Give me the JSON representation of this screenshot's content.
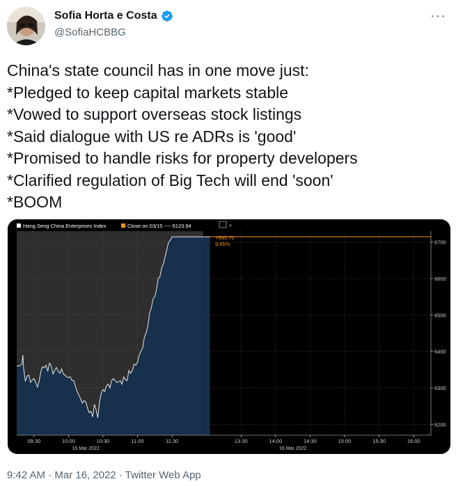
{
  "author": {
    "name": "Sofia Horta e Costa",
    "handle": "@SofiaHCBBG",
    "avatar_icon": "profile-photo"
  },
  "tweet": {
    "lines": [
      "China's state council has in one move just:",
      "*Pledged to keep capital markets stable",
      "*Vowed to support overseas stock listings",
      "*Said dialogue with US re ADRs is 'good'",
      "*Promised to handle risks for property developers",
      "*Clarified regulation of Big Tech will end 'soon'",
      "*BOOM"
    ],
    "timestamp": "9:42 AM · Mar 16, 2022 · Twitter Web App"
  },
  "colors": {
    "accent": "#1d9bf0",
    "text": "#0f1419",
    "muted": "#536471",
    "chart_fill": "#16304d",
    "chart_line": "#e8e8e8",
    "close_line": "#f7931a"
  },
  "chart_data": {
    "type": "area",
    "legend": [
      {
        "label": "Hang Seng China Enterprises Index",
        "swatch": "#ffffff"
      },
      {
        "label": "Close on 03/15 ---- 6123.94",
        "swatch": "#f7931a"
      }
    ],
    "annotation": {
      "value": "+590.70",
      "pct": "9.65%"
    },
    "x_ticks": [
      "09:30",
      "10:00",
      "10:30",
      "11:00",
      "11:30",
      "13:30",
      "14:00",
      "14:30",
      "15:00",
      "15:30",
      "16:00"
    ],
    "date_labels": [
      "16 Mar 2022",
      "16 Mar 2022"
    ],
    "y_ticks": [
      6200,
      6300,
      6400,
      6500,
      6600,
      6700
    ],
    "ylim": [
      6170,
      6730
    ],
    "close_level": 6714.6,
    "series": [
      {
        "x": [
          0,
          0.75,
          1.5,
          1.8,
          2,
          2.25,
          2.5,
          3,
          3.5,
          4,
          4.5,
          5,
          5.5,
          6,
          6.5,
          7,
          7.5,
          8,
          8.5,
          9,
          9.5,
          10,
          10.5,
          11,
          11.5,
          12,
          12.5,
          13,
          13.5,
          14,
          14.5,
          15,
          15.5,
          16,
          16.5,
          17,
          17.5,
          18,
          18.5,
          19,
          19.5,
          20,
          20.5,
          21,
          21.5,
          22,
          22.5,
          23,
          23.5,
          24,
          24.5,
          25,
          25.5,
          26,
          26.5,
          27,
          27.5,
          28,
          28.5,
          29,
          29.5,
          30,
          30.5,
          31,
          31.5,
          32,
          32.5,
          33,
          33.5,
          34,
          34.5,
          35,
          35.5,
          36,
          36.5,
          37,
          37.5,
          38,
          38.5,
          39,
          39.5,
          40,
          40.5,
          41,
          41.5,
          42,
          42.5,
          43,
          43.5,
          44,
          44.5,
          45,
          45.5,
          46,
          46.5,
          47,
          47.5,
          48,
          48.5,
          49,
          49.5,
          50,
          50.5,
          51,
          51.5,
          52,
          52.5,
          53,
          53.5,
          54,
          54.5,
          55,
          55.5,
          56
        ],
        "values": [
          6360,
          6360,
          6365,
          6390,
          6355,
          6335,
          6318,
          6332,
          6335,
          6315,
          6322,
          6325,
          6315,
          6302,
          6318,
          6345,
          6358,
          6355,
          6362,
          6345,
          6368,
          6360,
          6338,
          6348,
          6356,
          6345,
          6340,
          6352,
          6338,
          6335,
          6330,
          6328,
          6330,
          6320,
          6320,
          6305,
          6290,
          6280,
          6270,
          6258,
          6265,
          6262,
          6245,
          6232,
          6236,
          6220,
          6255,
          6240,
          6218,
          6262,
          6285,
          6295,
          6290,
          6305,
          6310,
          6300,
          6320,
          6325,
          6320,
          6315,
          6316,
          6320,
          6310,
          6330,
          6322,
          6320,
          6348,
          6340,
          6348,
          6365,
          6362,
          6370,
          6390,
          6400,
          6410,
          6440,
          6450,
          6470,
          6505,
          6520,
          6545,
          6550,
          6570,
          6600,
          6605,
          6630,
          6640,
          6660,
          6680,
          6700,
          6705,
          6714.6,
          6714.6,
          6714.6,
          6714.6,
          6714.6,
          6714.6,
          6714.6,
          6714.6,
          6714.6,
          6714.6,
          6714.6,
          6714.6,
          6714.6,
          6714.6,
          6714.6,
          6714.6,
          6714.6,
          6714.6,
          6714.6,
          6714.6,
          6714.6,
          6714.6,
          6714.6
        ]
      }
    ]
  }
}
